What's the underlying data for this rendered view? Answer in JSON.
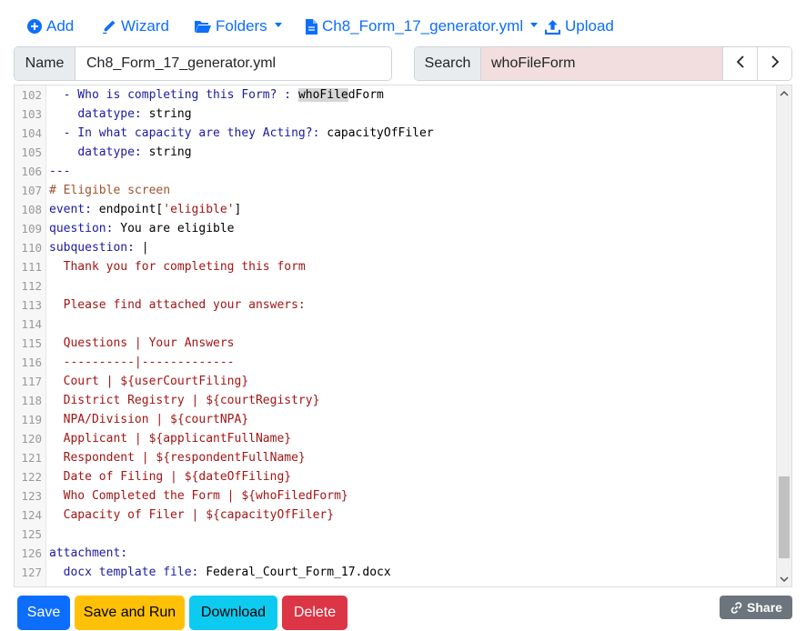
{
  "toolbar": {
    "add": "Add",
    "wizard": "Wizard",
    "folders": "Folders",
    "file": "Ch8_Form_17_generator.yml",
    "upload": "Upload"
  },
  "name_field": {
    "label": "Name",
    "value": "Ch8_Form_17_generator.yml"
  },
  "search_field": {
    "label": "Search",
    "value": "whoFileForm"
  },
  "code_lines": [
    {
      "n": "102",
      "html": "  <span class=\"k\">- Who is completing this Form? : </span><span class=\"hl\">whoFile</span>dForm"
    },
    {
      "n": "103",
      "html": "    <span class=\"k\">datatype:</span> string"
    },
    {
      "n": "104",
      "html": "  <span class=\"k\">- In what capacity are they Acting?:</span> capacityOfFiler"
    },
    {
      "n": "105",
      "html": "    <span class=\"k\">datatype:</span> string"
    },
    {
      "n": "106",
      "html": "<span class=\"k\">---</span>"
    },
    {
      "n": "107",
      "html": "<span class=\"c\"># Eligible screen</span>"
    },
    {
      "n": "108",
      "html": "<span class=\"k\">event:</span> endpoint[<span class=\"s\">'eligible'</span>]"
    },
    {
      "n": "109",
      "html": "<span class=\"k\">question:</span> You are eligible"
    },
    {
      "n": "110",
      "html": "<span class=\"k\">subquestion:</span> |"
    },
    {
      "n": "111",
      "html": "  <span class=\"s\">Thank you for completing this form</span>"
    },
    {
      "n": "112",
      "html": ""
    },
    {
      "n": "113",
      "html": "  <span class=\"s\">Please find attached your answers:</span>"
    },
    {
      "n": "114",
      "html": ""
    },
    {
      "n": "115",
      "html": "  <span class=\"s\">Questions | Your Answers</span>"
    },
    {
      "n": "116",
      "html": "  <span class=\"s\">----------|-------------</span>"
    },
    {
      "n": "117",
      "html": "  <span class=\"s\">Court | ${userCourtFiling}</span>"
    },
    {
      "n": "118",
      "html": "  <span class=\"s\">District Registry | ${courtRegistry}</span>"
    },
    {
      "n": "119",
      "html": "  <span class=\"s\">NPA/Division | ${courtNPA}</span>"
    },
    {
      "n": "120",
      "html": "  <span class=\"s\">Applicant | ${applicantFullName}</span>"
    },
    {
      "n": "121",
      "html": "  <span class=\"s\">Respondent | ${respondentFullName}</span>"
    },
    {
      "n": "122",
      "html": "  <span class=\"s\">Date of Filing | ${dateOfFiling}</span>"
    },
    {
      "n": "123",
      "html": "  <span class=\"s\">Who Completed the Form | ${whoFiledForm}</span>"
    },
    {
      "n": "124",
      "html": "  <span class=\"s\">Capacity of Filer | ${capacityOfFiler}</span>"
    },
    {
      "n": "125",
      "html": ""
    },
    {
      "n": "126",
      "html": "<span class=\"k\">attachment:</span>"
    },
    {
      "n": "127",
      "html": "  <span class=\"k\">docx template file:</span> Federal_Court_Form_17.docx"
    }
  ],
  "buttons": {
    "save": "Save",
    "save_run": "Save and Run",
    "download": "Download",
    "delete": "Delete",
    "share": "Share"
  },
  "colors": {
    "primary": "#0d6efd",
    "warning": "#ffc107",
    "info": "#0dcaf0",
    "danger": "#dc3545",
    "secondary": "#6c757d",
    "search_bg": "#f2dede"
  }
}
